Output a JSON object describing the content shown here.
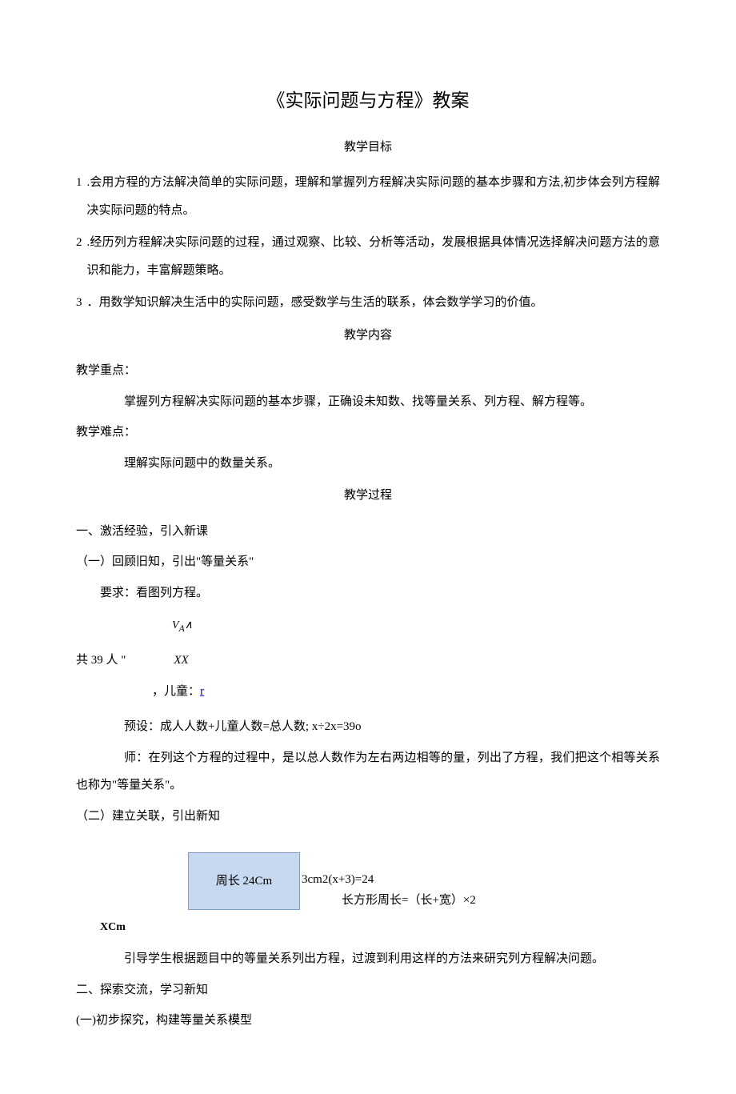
{
  "title": "《实际问题与方程》教案",
  "sections": {
    "goals_heading": "教学目标",
    "goals": [
      {
        "num": "1",
        "text": ".会用方程的方法解决简单的实际问题，理解和掌握列方程解决实际问题的基本步骤和方法,初步体会列方程解决实际问题的特点。"
      },
      {
        "num": "2",
        "text": ".经历列方程解决实际问题的过程，通过观察、比较、分析等活动，发展根据具体情况选择解决问题方法的意识和能力，丰富解题策略。"
      },
      {
        "num": "3",
        "text": "．用数学知识解决生活中的实际问题，感受数学与生活的联系，体会数学学习的价值。"
      }
    ],
    "content_heading": "教学内容",
    "focus_label": "教学重点：",
    "focus_text": "掌握列方程解决实际问题的基本步骤，正确设未知数、找等量关系、列方程、解方程等。",
    "difficulty_label": "教学难点：",
    "difficulty_text": "理解实际问题中的数量关系。",
    "process_heading": "教学过程",
    "part1": "一、激活经验，引入新课",
    "part1_1": "（一）回顾旧知，引出\"等量关系\"",
    "requirement": "要求：看图列方程。",
    "va": "V",
    "va_sub": "A",
    "va_caret": "∧",
    "shared_prefix": "共 39 人 \"",
    "shared_xx": "XX",
    "child_label": "，儿童：",
    "child_r": "r",
    "preset": "预设：成人人数+儿童人数=总人数; x÷2x=39o",
    "teacher_say": "师：在列这个方程的过程中，是以总人数作为左右两边相等的量，列出了方程，我们把这个相等关系也称为\"等量关系\"。",
    "part1_2": "（二）建立关联，引出新知",
    "rect_label": "周长 24Cm",
    "rect_right_top": "3cm2(x+3)=24",
    "rect_right_bottom": "长方形周长=（长+宽）×2",
    "xcm": "XCm",
    "guide_text": "引导学生根据题目中的等量关系列出方程，过渡到利用这样的方法来研究列方程解决问题。",
    "part2": "二、探索交流，学习新知",
    "part2_1": "(一)初步探究，构建等量关系模型"
  }
}
